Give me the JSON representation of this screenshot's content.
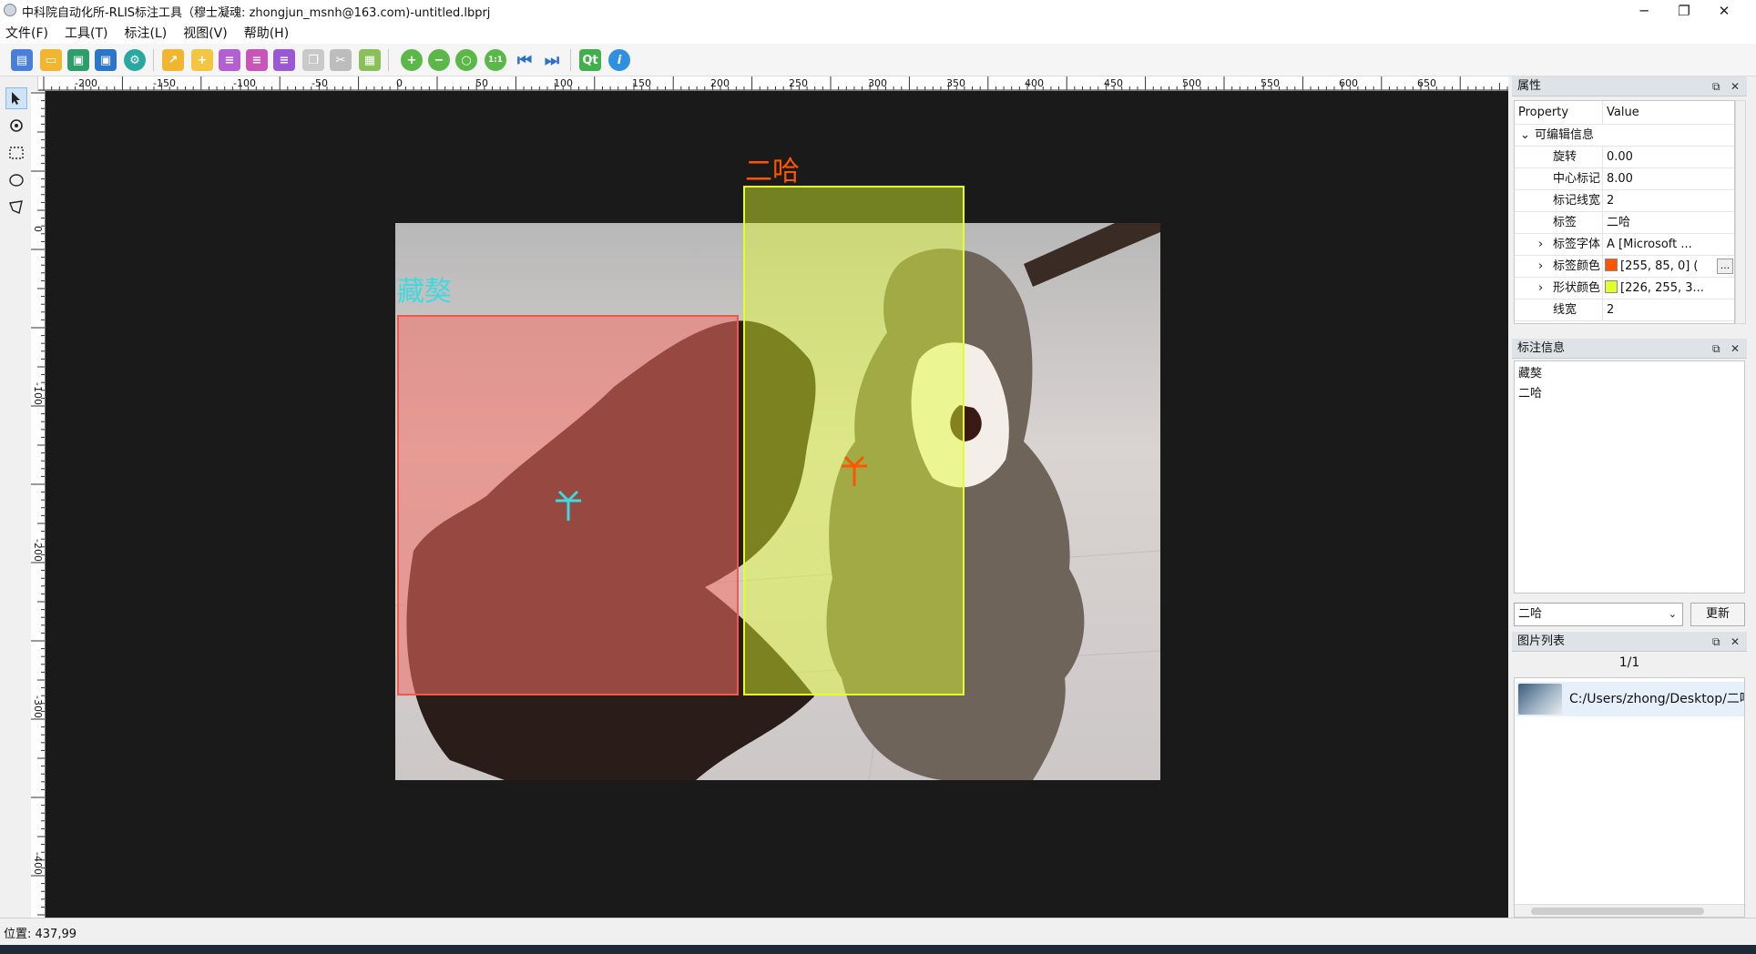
{
  "window": {
    "title": "中科院自动化所-RLIS标注工具（穆士凝魂: zhongjun_msnh@163.com)-untitled.lbprj",
    "min": "─",
    "max": "❐",
    "close": "✕"
  },
  "menu": [
    "文件(F)",
    "工具(T)",
    "标注(L)",
    "视图(V)",
    "帮助(H)"
  ],
  "toolbar": {
    "icons": [
      "new-file-icon",
      "open-folder-icon",
      "save-icon",
      "save-as-icon",
      "settings-icon",
      "open-dir-icon",
      "add-folder-icon",
      "add-layer-icon",
      "remove-layer-icon",
      "move-layer-icon",
      "copy-icon",
      "cut-icon",
      "paste-icon",
      "zoom-in-icon",
      "zoom-out-icon",
      "zoom-fit-icon",
      "zoom-1to1-icon",
      "first-image-icon",
      "last-image-icon",
      "qt-icon",
      "info-icon"
    ],
    "zoom_1to1": "1:1",
    "qt": "Qt",
    "info": "i"
  },
  "tools": [
    "pointer-tool-icon",
    "rotate-tool-icon",
    "rectangle-tool-icon",
    "ellipse-tool-icon",
    "polygon-tool-icon"
  ],
  "ruler": {
    "h_labels": [
      "-200",
      "-150",
      "-100",
      "-50",
      "0",
      "50",
      "100",
      "150",
      "200",
      "250",
      "300",
      "350",
      "400",
      "450",
      "500",
      "550",
      "600",
      "650"
    ],
    "v_labels": [
      "0",
      "-100",
      "-200",
      "-300",
      "-400"
    ]
  },
  "annotations": [
    {
      "label": "藏獒",
      "label_color": "#3fd9e0",
      "shape_color": "#f05a4a",
      "fill": "rgba(240,110,100,0.55)"
    },
    {
      "label": "二哈",
      "label_color": "#ff5500",
      "shape_color": "#e2ff2c",
      "fill": "rgba(226,255,44,0.45)"
    }
  ],
  "properties": {
    "title": "属性",
    "col_property": "Property",
    "col_value": "Value",
    "group": "可编辑信息",
    "rows": [
      {
        "name": "旋转",
        "value": "0.00"
      },
      {
        "name": "中心标记",
        "value": "8.00"
      },
      {
        "name": "标记线宽",
        "value": "2"
      },
      {
        "name": "标签",
        "value": "二哈"
      },
      {
        "name": "标签字体",
        "value": "A  [Microsoft ..."
      },
      {
        "name": "标签颜色",
        "value": "[255, 85, 0] (",
        "swatch": "#ff5500",
        "button": "..."
      },
      {
        "name": "形状颜色",
        "value": "[226, 255, 3...",
        "swatch": "#e2ff2c"
      },
      {
        "name": "线宽",
        "value": "2"
      }
    ]
  },
  "annotation_panel": {
    "title": "标注信息",
    "items": [
      "藏獒",
      "二哈"
    ],
    "selected_label": "二哈",
    "update_button": "更新"
  },
  "image_panel": {
    "title": "图片列表",
    "counter": "1/1",
    "items": [
      "C:/Users/zhong/Desktop/二哈"
    ]
  },
  "status": {
    "position": "位置: 437,99"
  }
}
